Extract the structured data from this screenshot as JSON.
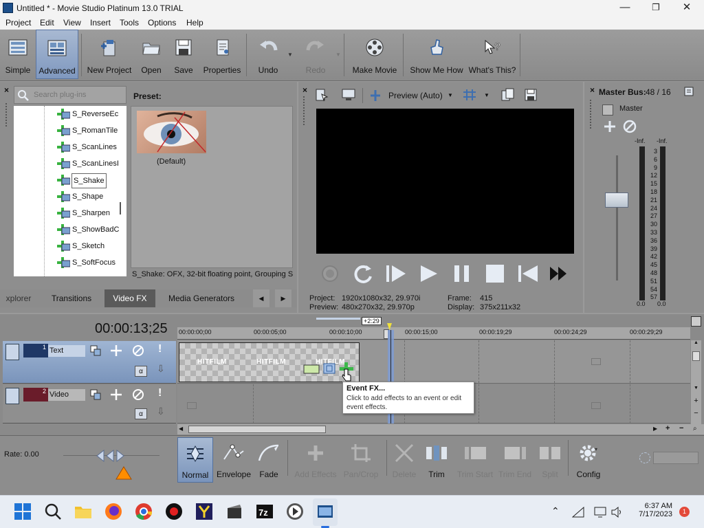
{
  "window": {
    "title": "Untitled * - Movie Studio Platinum 13.0 TRIAL",
    "minimize": "—",
    "restore": "❐",
    "close": "✕"
  },
  "menu": [
    "Project",
    "Edit",
    "View",
    "Insert",
    "Tools",
    "Options",
    "Help"
  ],
  "toolbar": {
    "simple": "Simple",
    "advanced": "Advanced",
    "new_project": "New Project",
    "open": "Open",
    "save": "Save",
    "properties": "Properties",
    "undo": "Undo",
    "redo": "Redo",
    "make_movie": "Make Movie",
    "show_me_how": "Show Me How",
    "whats_this": "What's This?"
  },
  "plugins": {
    "search_placeholder": "Search plug-ins",
    "items": [
      "S_ReverseEc",
      "S_RomanTile",
      "S_ScanLines",
      "S_ScanLinesI",
      "S_Shake",
      "S_Shape",
      "S_Sharpen",
      "S_ShowBadC",
      "S_Sketch",
      "S_SoftFocus"
    ],
    "selected": "S_Shake",
    "preset_label": "Preset:",
    "preset_name": "(Default)",
    "status": "S_Shake: OFX, 32-bit floating point, Grouping S"
  },
  "tabs": [
    "xplorer",
    "Transitions",
    "Video FX",
    "Media Generators"
  ],
  "tab_nav": {
    "prev": "◀",
    "next": "▶"
  },
  "preview": {
    "mode": "Preview (Auto)",
    "project_label": "Project:",
    "project_value": "1920x1080x32, 29.970i",
    "preview_label": "Preview:",
    "preview_value": "480x270x32, 29.970p",
    "frame_label": "Frame:",
    "frame_value": "415",
    "display_label": "Display:",
    "display_value": "375x211x32"
  },
  "master": {
    "title": "Master Bus:",
    "value": "48 / 16",
    "label": "Master",
    "inf_left": "-Inf.",
    "inf_right": "-Inf.",
    "scale": [
      "3",
      "6",
      "9",
      "12",
      "15",
      "18",
      "21",
      "24",
      "27",
      "30",
      "33",
      "36",
      "39",
      "42",
      "45",
      "48",
      "51",
      "54",
      "57"
    ],
    "zero_left": "0.0",
    "zero_right": "0.0"
  },
  "timeline": {
    "timecode": "00:00:13;25",
    "duration_badge": "+2:29",
    "ruler": [
      "00:00:00;00",
      "00:00:05;00",
      "00:00:10;00",
      "00:00:15;00",
      "00:00:19;29",
      "00:00:24;29",
      "00:00:29;29"
    ],
    "tracks": [
      {
        "num": "1",
        "name": "Text"
      },
      {
        "num": "2",
        "name": "Video"
      }
    ],
    "clip_labels": [
      "HITFILM",
      "HITFILM",
      "HITFILM"
    ],
    "tooltip_title": "Event FX...",
    "tooltip_body": "Click to add effects to an event or edit event effects.",
    "alpha": "α"
  },
  "bottom": {
    "rate": "Rate: 0.00",
    "normal": "Normal",
    "envelope": "Envelope",
    "fade": "Fade",
    "add_effects": "Add Effects",
    "pan_crop": "Pan/Crop",
    "delete": "Delete",
    "trim": "Trim",
    "trim_start": "Trim Start",
    "trim_end": "Trim End",
    "split": "Split",
    "config": "Config"
  },
  "taskbar": {
    "time": "6:37 AM",
    "date": "7/17/2023",
    "notif": "1"
  }
}
